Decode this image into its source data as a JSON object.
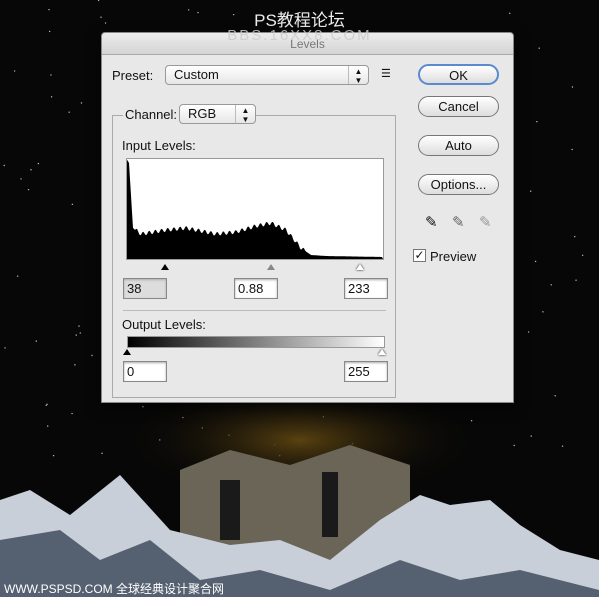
{
  "watermark": {
    "top_cn": "PS教程论坛",
    "top_url": "BBS.16XX8.COM",
    "bottom": "WWW.PSPSD.COM 全球经典设计聚合网"
  },
  "dialog": {
    "title": "Levels",
    "preset_label": "Preset:",
    "preset_value": "Custom",
    "channel_label": "Channel:",
    "channel_value": "RGB",
    "input_levels_label": "Input Levels:",
    "input_black": "38",
    "input_gamma": "0.88",
    "input_white": "233",
    "output_levels_label": "Output Levels:",
    "output_black": "0",
    "output_white": "255",
    "buttons": {
      "ok": "OK",
      "cancel": "Cancel",
      "auto": "Auto",
      "options": "Options..."
    },
    "preview_label": "Preview",
    "preview_checked": true
  }
}
